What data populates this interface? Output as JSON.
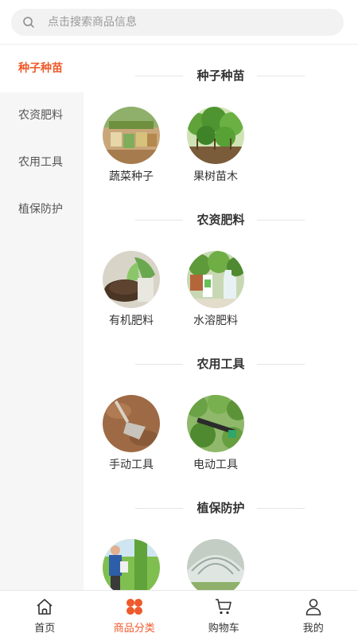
{
  "search": {
    "placeholder": "点击搜索商品信息",
    "icon": "search-icon"
  },
  "sidebar": {
    "items": [
      {
        "label": "种子种苗",
        "active": true
      },
      {
        "label": "农资肥料",
        "active": false
      },
      {
        "label": "农用工具",
        "active": false
      },
      {
        "label": "植保防护",
        "active": false
      }
    ]
  },
  "sections": [
    {
      "title": "种子种苗",
      "items": [
        {
          "label": "蔬菜种子"
        },
        {
          "label": "果树苗木"
        }
      ]
    },
    {
      "title": "农资肥料",
      "items": [
        {
          "label": "有机肥料"
        },
        {
          "label": "水溶肥料"
        }
      ]
    },
    {
      "title": "农用工具",
      "items": [
        {
          "label": "手动工具"
        },
        {
          "label": "电动工具"
        }
      ]
    },
    {
      "title": "植保防护",
      "items": [
        {
          "label": ""
        },
        {
          "label": ""
        }
      ]
    }
  ],
  "tabbar": {
    "tabs": [
      {
        "label": "首页",
        "icon": "home-icon",
        "active": false
      },
      {
        "label": "商品分类",
        "icon": "category-icon",
        "active": true
      },
      {
        "label": "购物车",
        "icon": "cart-icon",
        "active": false
      },
      {
        "label": "我的",
        "icon": "user-icon",
        "active": false
      }
    ]
  },
  "colors": {
    "accent": "#ee5a2c",
    "sidebar_bg": "#f6f6f6",
    "search_bg": "#f2f2f2"
  }
}
